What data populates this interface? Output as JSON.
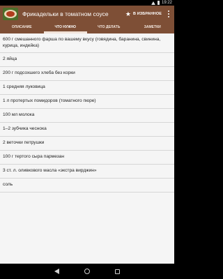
{
  "status_bar": {
    "time": "19:22",
    "icons": [
      "wifi-icon",
      "battery-icon"
    ]
  },
  "app_bar": {
    "title": "Фрикадельки в томатном соусе",
    "favorite_label": "В ИЗБРАННОЕ",
    "favorite_icon": "star-icon",
    "overflow_icon": "more-vert-icon",
    "thumbnail": "recipe-thumbnail"
  },
  "colors": {
    "app_bar": "#7e4f36",
    "tab_indicator": "#f1e3d9",
    "background": "#f5f5f5",
    "text": "#222222"
  },
  "tabs": [
    {
      "label": "ОПИСАНИЕ",
      "active": false
    },
    {
      "label": "ЧТО НУЖНО",
      "active": true
    },
    {
      "label": "ЧТО ДЕЛАТЬ",
      "active": false
    },
    {
      "label": "ЗАМЕТКИ",
      "active": false
    }
  ],
  "ingredients": [
    "600 г смешанного фарша по вашему вкусу (говядина, баранина, свинина, курица, индейка)",
    "2 яйца",
    "200 г подсохшего хлеба без корки",
    "1 средняя луковица",
    "1 л протертых помидоров (томатного пюре)",
    "100 мл молока",
    "1–2 зубчика чеснока",
    "2 веточки петрушки",
    "100 г тертого сыра пармезан",
    "3 ст. л. оливкового масла «экстра вирджин»",
    "соль"
  ],
  "nav_bar": {
    "icons": [
      "back-icon",
      "home-icon",
      "recent-apps-icon"
    ]
  }
}
